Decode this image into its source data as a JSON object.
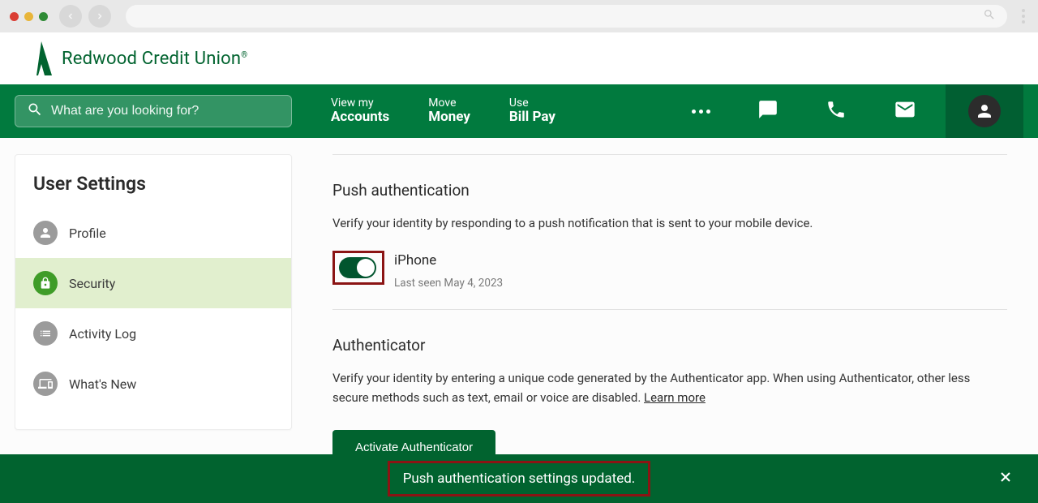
{
  "brand": {
    "name": "Redwood Credit Union"
  },
  "search": {
    "placeholder": "What are you looking for?"
  },
  "nav": {
    "links": [
      {
        "small": "View my",
        "big": "Accounts"
      },
      {
        "small": "Move",
        "big": "Money"
      },
      {
        "small": "Use",
        "big": "Bill Pay"
      }
    ]
  },
  "sidebar": {
    "title": "User Settings",
    "items": [
      {
        "label": "Profile"
      },
      {
        "label": "Security"
      },
      {
        "label": "Activity Log"
      },
      {
        "label": "What's New"
      }
    ]
  },
  "push": {
    "title": "Push authentication",
    "desc": "Verify your identity by responding to a push notification that is sent to your mobile device.",
    "device_name": "iPhone",
    "device_sub": "Last seen May 4, 2023",
    "toggle_on": true
  },
  "authenticator": {
    "title": "Authenticator",
    "desc_prefix": "Verify your identity by entering a unique code generated by the Authenticator app. When using Authenticator, other less secure methods such as text, email or voice are disabled. ",
    "learn_more": "Learn more",
    "button": "Activate Authenticator"
  },
  "toast": {
    "message": "Push authentication settings updated."
  }
}
